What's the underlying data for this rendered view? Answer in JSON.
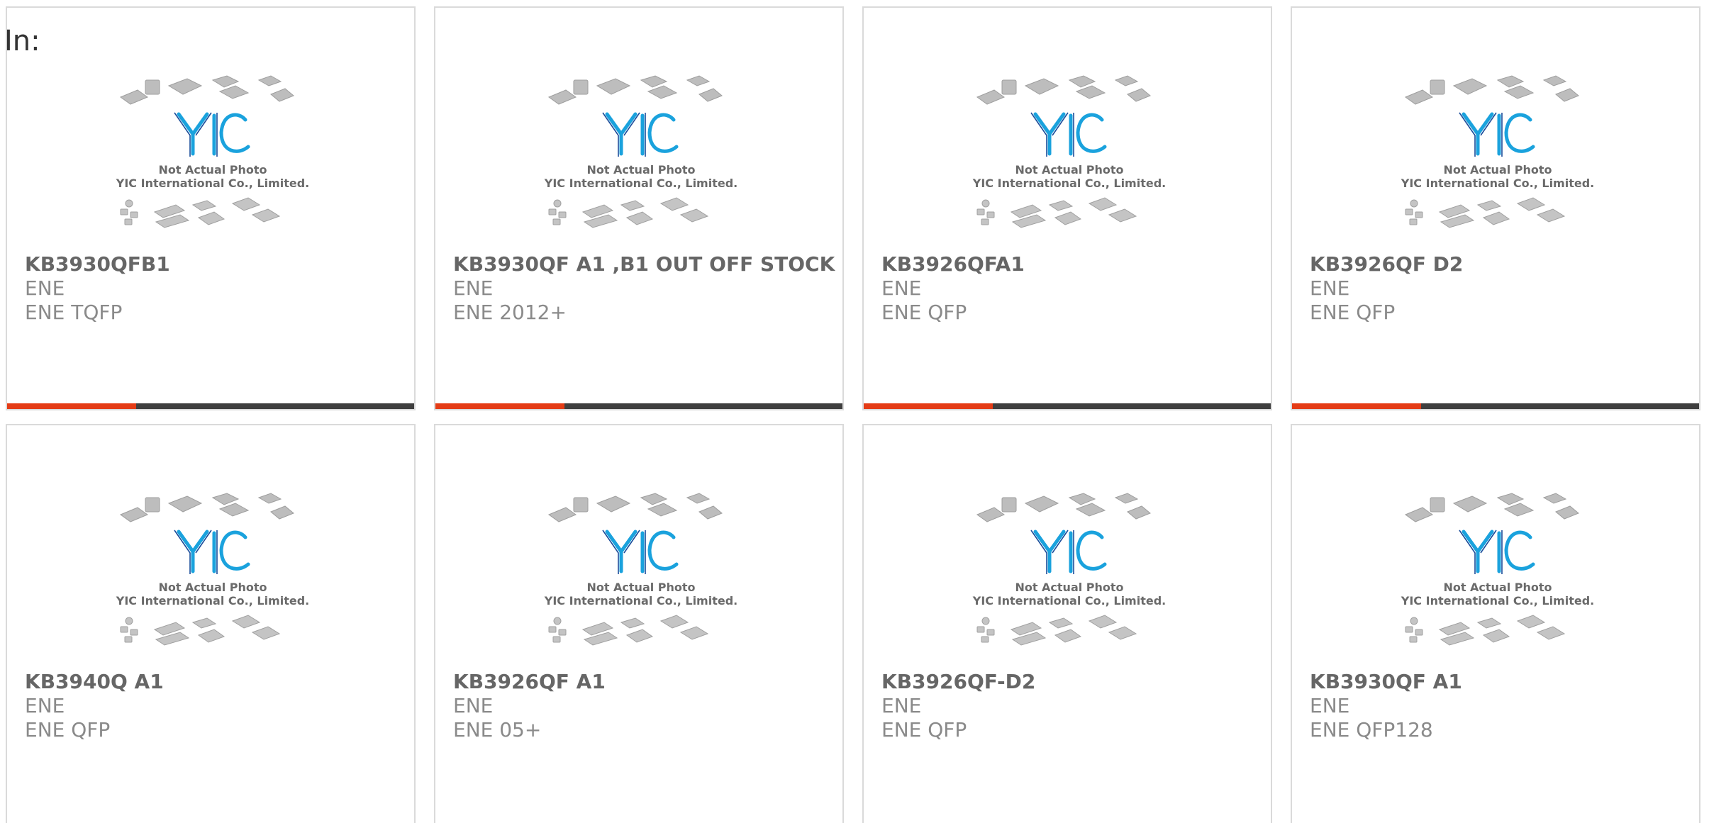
{
  "heading": {
    "label": "In:"
  },
  "image_caption": {
    "line1": "Not Actual Photo",
    "line2": "YIC International Co., Limited.",
    "logo": "YIC"
  },
  "colors": {
    "accent": "#e43c16",
    "bar": "#3f3f3f",
    "logo_blue": "#1aa2dd"
  },
  "products": [
    {
      "part": "KB3930QFB1",
      "brand": "ENE",
      "package": "ENE TQFP"
    },
    {
      "part": "KB3930QF A1 ,B1 OUT OFF STOCK",
      "brand": "ENE",
      "package": "ENE 2012+"
    },
    {
      "part": "KB3926QFA1",
      "brand": "ENE",
      "package": "ENE QFP"
    },
    {
      "part": "KB3926QF D2",
      "brand": "ENE",
      "package": "ENE QFP"
    },
    {
      "part": "KB3940Q A1",
      "brand": "ENE",
      "package": "ENE QFP"
    },
    {
      "part": "KB3926QF A1",
      "brand": "ENE",
      "package": "ENE 05+"
    },
    {
      "part": "KB3926QF-D2",
      "brand": "ENE",
      "package": "ENE QFP"
    },
    {
      "part": "KB3930QF A1",
      "brand": "ENE",
      "package": "ENE QFP128"
    }
  ]
}
